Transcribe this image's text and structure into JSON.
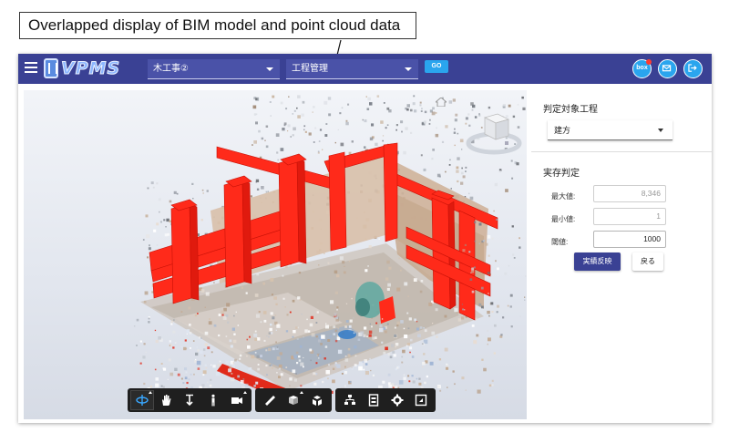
{
  "annotation": {
    "text": "Overlapped display of BIM model and point cloud data"
  },
  "header": {
    "logo_text": "VPMS",
    "project_select": {
      "value": "木工事②"
    },
    "process_select": {
      "value": "工程管理"
    },
    "go_label": "GO",
    "box_label": "box",
    "accent": "#3a4194",
    "button_color": "#2aa5ee"
  },
  "viewer": {
    "toolbar_icons": [
      "orbit-icon",
      "pan-hand-icon",
      "zoom-icon",
      "walk-person-icon",
      "camera-icon",
      "measure-icon",
      "section-box-icon",
      "explode-cube-icon",
      "model-tree-icon",
      "properties-icon",
      "settings-gear-icon",
      "fullscreen-icon"
    ],
    "bim_color": "#ff2a1a"
  },
  "panel": {
    "target_process_title": "判定対象工程",
    "target_process_value": "建方",
    "judgement_title": "実存判定",
    "rows": [
      {
        "label": "最大値:",
        "value": "8,346"
      },
      {
        "label": "最小値:",
        "value": "1"
      },
      {
        "label": "閾値:",
        "value": "1000"
      }
    ],
    "apply_button": "実績反映",
    "back_button": "戻る"
  }
}
